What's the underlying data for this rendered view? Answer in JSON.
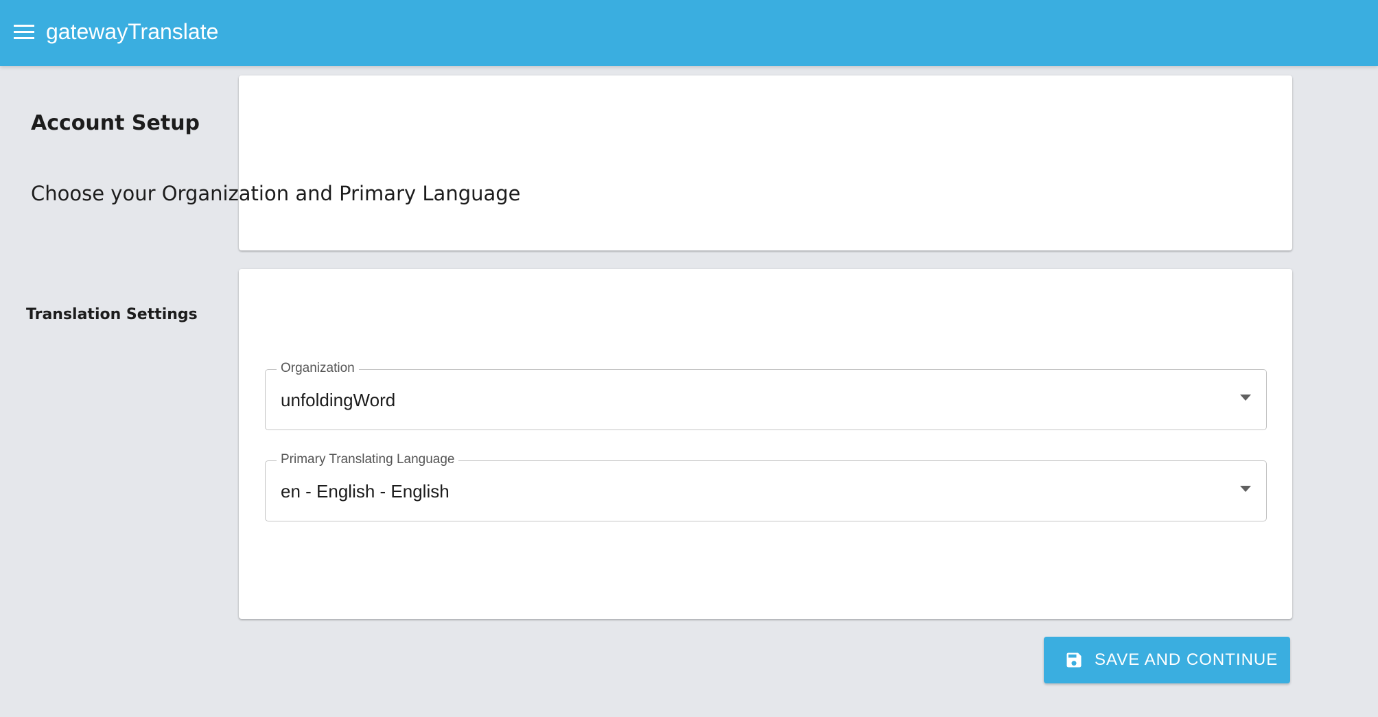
{
  "app": {
    "title": "gatewayTranslate",
    "accent_color": "#3aaee0",
    "menu_icon": "hamburger-menu-icon"
  },
  "header_card": {
    "title": "Account Setup",
    "subtitle": "Choose your Organization and Primary Language"
  },
  "settings_card": {
    "title": "Translation Settings",
    "organization": {
      "label": "Organization",
      "value": "unfoldingWord"
    },
    "language": {
      "label": "Primary Translating Language",
      "value": "en - English - English"
    }
  },
  "actions": {
    "save_label": "SAVE AND CONTINUE",
    "save_icon": "floppy-disk-icon"
  }
}
